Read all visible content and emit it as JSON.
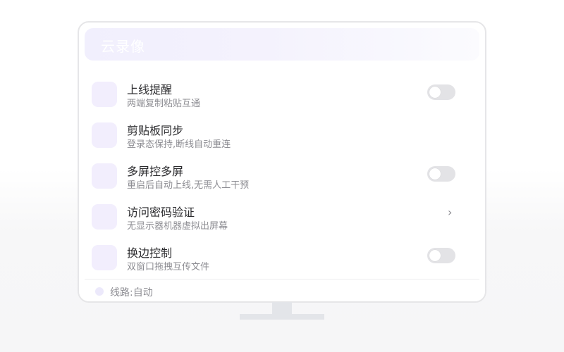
{
  "header": {
    "title": "云录像"
  },
  "rows": [
    {
      "title": "上线提醒",
      "subtitle": "两端复制粘贴互通",
      "control": "toggle",
      "on": false
    },
    {
      "title": "剪贴板同步",
      "subtitle": "登录态保持,断线自动重连",
      "control": "none"
    },
    {
      "title": "多屏控多屏",
      "subtitle": "重启后自动上线,无需人工干预",
      "control": "toggle",
      "on": false
    },
    {
      "title": "访问密码验证",
      "subtitle": "无显示器机器虚拟出屏幕",
      "control": "chevron",
      "chevron": "›"
    },
    {
      "title": "换边控制",
      "subtitle": "双窗口拖拽互传文件",
      "control": "toggle",
      "on": false
    }
  ],
  "footer": {
    "text": "线路:自动"
  },
  "colors": {
    "accent_tint": "#f2eefd",
    "toggle_off": "#e3e3e6",
    "stand": "#e3e5e9"
  }
}
